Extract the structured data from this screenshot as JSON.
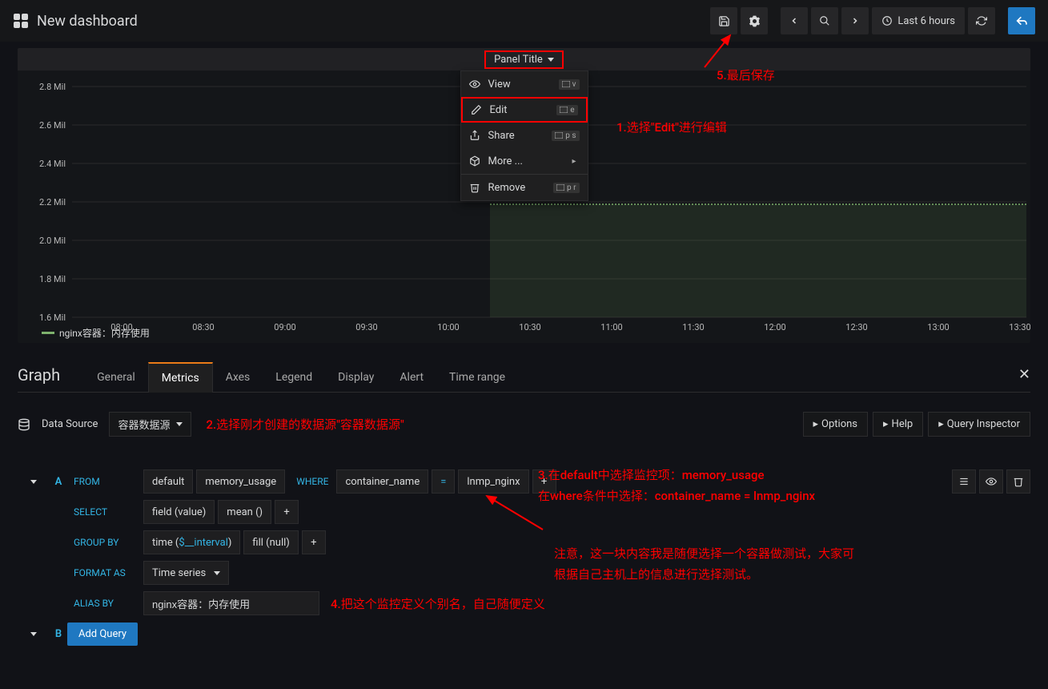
{
  "header": {
    "title": "New dashboard",
    "time_range": "Last 6 hours"
  },
  "panel": {
    "title": "Panel Title",
    "menu": {
      "view": "View",
      "view_key": "v",
      "edit": "Edit",
      "edit_key": "e",
      "share": "Share",
      "share_key": "p s",
      "more": "More ...",
      "remove": "Remove",
      "remove_key": "p r"
    },
    "legend": "nginx容器：内存使用"
  },
  "chart_data": {
    "type": "line",
    "ylabel": "",
    "ylim": [
      1600000,
      2800000
    ],
    "ytick_labels": [
      "1.6 Mil",
      "1.8 Mil",
      "2.0 Mil",
      "2.2 Mil",
      "2.4 Mil",
      "2.6 Mil",
      "2.8 Mil"
    ],
    "ytick_values": [
      1600000,
      1800000,
      2000000,
      2200000,
      2400000,
      2600000,
      2800000
    ],
    "x_labels": [
      "08:00",
      "08:30",
      "09:00",
      "09:30",
      "10:00",
      "10:30",
      "11:00",
      "11:30",
      "12:00",
      "12:30",
      "13:00",
      "13:30"
    ],
    "series": [
      {
        "name": "nginx容器：内存使用",
        "color": "#7eb26d",
        "x": [
          "10:15",
          "13:40"
        ],
        "y": [
          2190000,
          2190000
        ]
      }
    ],
    "fill": true
  },
  "editor": {
    "title": "Graph",
    "tabs": [
      "General",
      "Metrics",
      "Axes",
      "Legend",
      "Display",
      "Alert",
      "Time range"
    ],
    "active_tab": "Metrics"
  },
  "datasource": {
    "label": "Data Source",
    "selected": "容器数据源",
    "options_btn": "Options",
    "help_btn": "Help",
    "inspector_btn": "Query Inspector"
  },
  "query": {
    "letter_a": "A",
    "letter_b": "B",
    "from": "FROM",
    "from_retention": "default",
    "from_measurement": "memory_usage",
    "where": "WHERE",
    "where_tag": "container_name",
    "where_op": "=",
    "where_val": "lnmp_nginx",
    "select": "SELECT",
    "select_field": "field (value)",
    "select_agg": "mean ()",
    "groupby": "GROUP BY",
    "groupby_time_prefix": "time (",
    "groupby_time_var": "$__interval",
    "groupby_time_suffix": ")",
    "groupby_fill": "fill (null)",
    "formatas": "FORMAT AS",
    "formatas_val": "Time series",
    "aliasby": "ALIAS BY",
    "aliasby_val": "nginx容器：内存使用",
    "add_query": "Add Query"
  },
  "annotations": {
    "a1": "1.选择\"Edit\"进行编辑",
    "a2": "2.选择刚才创建的数据源\"容器数据源\"",
    "a3a": "3.在default中选择监控项：memory_usage",
    "a3b": "在where条件中选择：container_name = lnmp_nginx",
    "a3note1": "注意，这一块内容我是随便选择一个容器做测试，大家可",
    "a3note2": "根据自己主机上的信息进行选择测试。",
    "a4": "4.把这个监控定义个别名，自己随便定义",
    "a5": "5.最后保存"
  }
}
